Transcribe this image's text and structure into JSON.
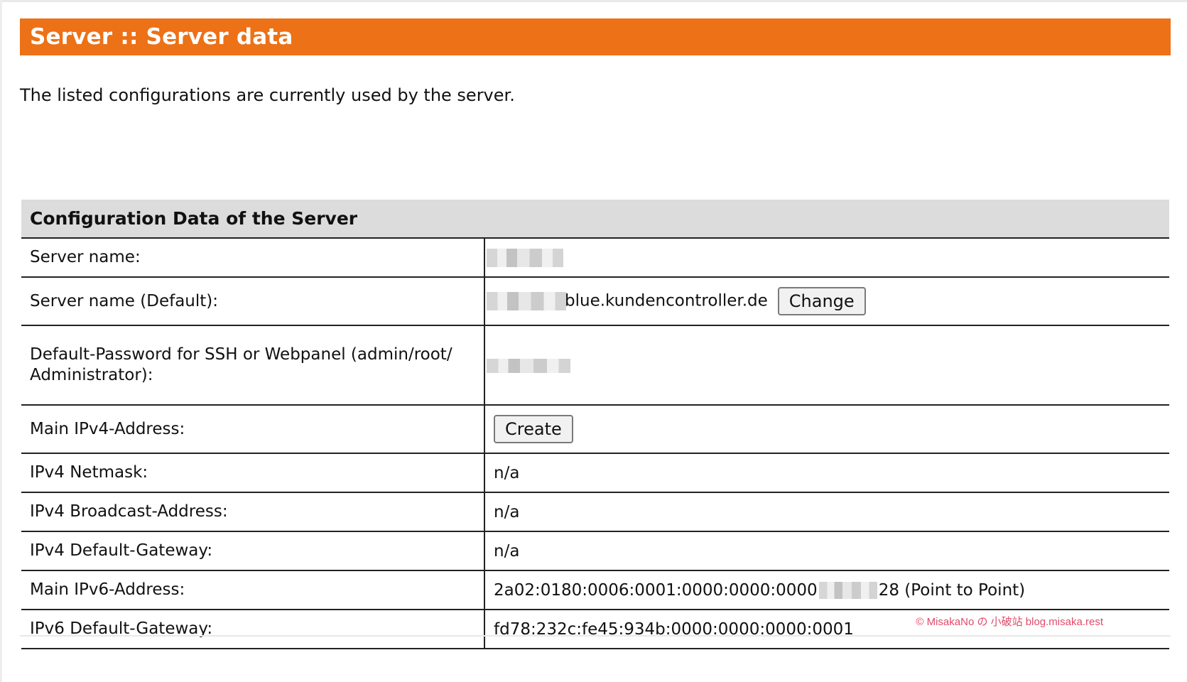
{
  "header": {
    "title": "Server :: Server data",
    "accent_color": "#ed7116"
  },
  "intro_text": "The listed configurations are currently used by the server.",
  "table": {
    "caption": "Configuration Data of the Server",
    "rows": [
      {
        "label": "Server name:",
        "value": ""
      },
      {
        "label": "Server name (Default):",
        "value_suffix": "blue.kundencontroller.de",
        "button": "Change"
      },
      {
        "label": "Default-Password for SSH or Webpanel (admin/root/ Administrator):",
        "value": ""
      },
      {
        "label": "Main IPv4-Address:",
        "button": "Create"
      },
      {
        "label": "IPv4 Netmask:",
        "value": "n/a"
      },
      {
        "label": "IPv4 Broadcast-Address:",
        "value": "n/a"
      },
      {
        "label": "IPv4 Default-Gateway:",
        "value": "n/a"
      },
      {
        "label": "Main IPv6-Address:",
        "value_prefix": "2a02:0180:0006:0001:0000:0000:0000",
        "value_suffix": "28 (Point to Point)"
      },
      {
        "label": "IPv6 Default-Gateway:",
        "value": "fd78:232c:fe45:934b:0000:0000:0000:0001"
      }
    ]
  },
  "watermark": "© MisakaNo の 小破站 blog.misaka.rest"
}
